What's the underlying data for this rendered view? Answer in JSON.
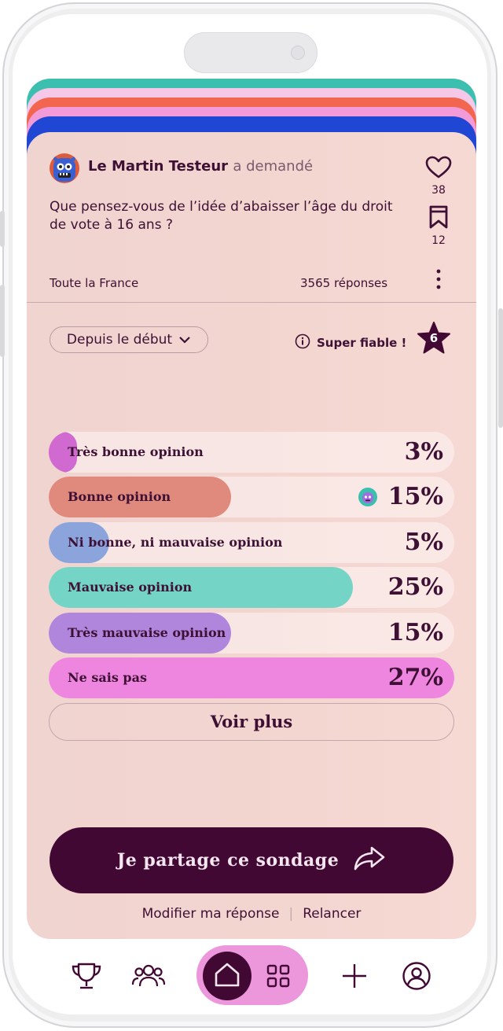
{
  "poll": {
    "author": "Le Martin Testeur",
    "asked_suffix": "a demandé",
    "question": "Que pensez-vous de l’idée d’abaisser l’âge du droit de vote à 16 ans ?",
    "likes": "38",
    "bookmarks": "12",
    "region": "Toute la France",
    "responses": "3565 réponses"
  },
  "filters": {
    "period": "Depuis le début",
    "reliability": "Super fiable !",
    "level": "6"
  },
  "results": [
    {
      "label": "Très bonne opinion",
      "percent": "3%",
      "fill_fraction": 0.07,
      "color": "#d06ad0"
    },
    {
      "label": "Bonne opinion",
      "percent": "15%",
      "fill_fraction": 0.45,
      "color": "#e08a7e"
    },
    {
      "label": "Ni bonne, ni mauvaise opinion",
      "percent": "5%",
      "fill_fraction": 0.15,
      "color": "#8ca4dc"
    },
    {
      "label": "Mauvaise opinion",
      "percent": "25%",
      "fill_fraction": 0.75,
      "color": "#74d4c6"
    },
    {
      "label": "Très mauvaise opinion",
      "percent": "15%",
      "fill_fraction": 0.45,
      "color": "#b085dc"
    },
    {
      "label": "Ne sais pas",
      "percent": "27%",
      "fill_fraction": 1.0,
      "color": "#ee86e0"
    }
  ],
  "actions": {
    "see_more": "Voir plus",
    "share": "Je partage ce sondage",
    "modify": "Modifier ma réponse",
    "relaunch": "Relancer"
  },
  "nav": {
    "items": [
      "trophy-icon",
      "friends-icon",
      "home-icon",
      "grid-icon",
      "plus-icon",
      "profile-icon"
    ]
  },
  "colors": {
    "primary": "#410834",
    "card_bg": "#f3d5d0",
    "stack": [
      "#3cbfae",
      "#f2b8e4",
      "#f26650",
      "#f39ad8",
      "#1f47d4"
    ]
  }
}
